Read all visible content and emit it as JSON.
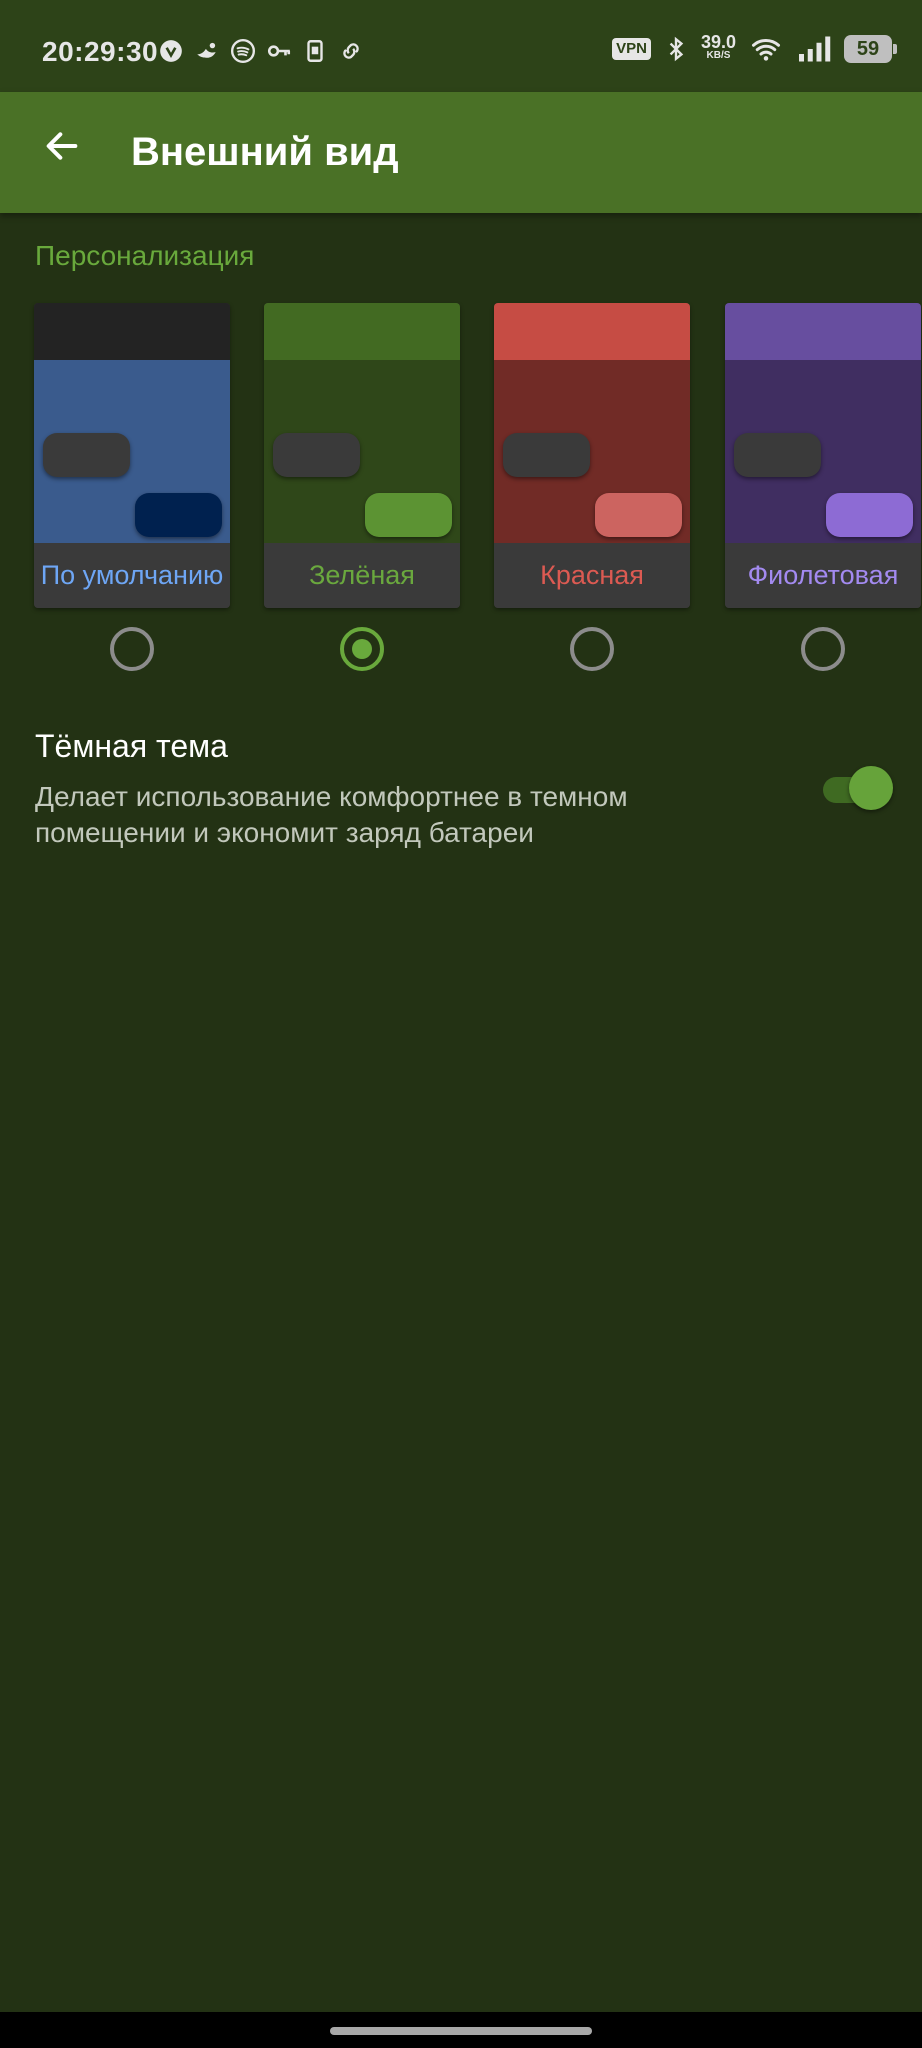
{
  "status_bar": {
    "time": "20:29:30",
    "left_icons": [
      "vpn-shield-icon",
      "bird-icon",
      "spotify-icon",
      "key-icon",
      "sim-icon",
      "link-icon"
    ],
    "vpn": "VPN",
    "speed_value": "39.0",
    "speed_unit": "KB/S",
    "battery": "59"
  },
  "toolbar": {
    "back_icon": "arrow-back-icon",
    "title": "Внешний вид"
  },
  "personalization": {
    "header": "Персонализация",
    "themes": [
      {
        "label": "По умолчанию",
        "selected": false,
        "colors": {
          "top": "#232323",
          "body": "#3a5b8d",
          "pill": "#00214f",
          "label": "#6ea6f5"
        }
      },
      {
        "label": "Зелёная",
        "selected": true,
        "colors": {
          "top": "#426a22",
          "body": "#2f4719",
          "pill": "#5c9333",
          "label": "#6aa83e"
        }
      },
      {
        "label": "Красная",
        "selected": false,
        "colors": {
          "top": "#c64c44",
          "body": "#712b26",
          "pill": "#cc6460",
          "label": "#dc5a52"
        }
      },
      {
        "label": "Фиолетовая",
        "selected": false,
        "colors": {
          "top": "#674e9f",
          "body": "#402e61",
          "pill": "#8d6bd4",
          "label": "#a38af0"
        }
      }
    ]
  },
  "dark_theme": {
    "title": "Тёмная тема",
    "description": "Делает использование комфортнее в темном помещении и экономит заряд батареи",
    "enabled": true
  },
  "colors": {
    "background": "#233214",
    "status_bar": "#2d4318",
    "toolbar": "#4a7126",
    "accent": "#69a93c"
  }
}
